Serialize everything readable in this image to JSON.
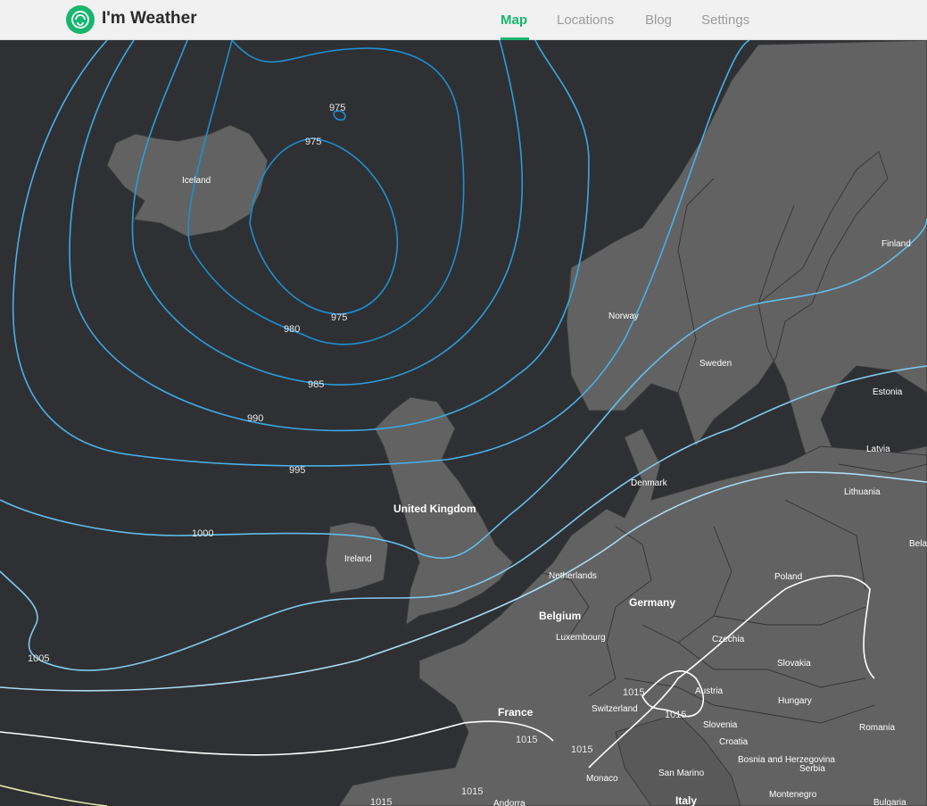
{
  "app": {
    "title": "I'm Weather"
  },
  "nav": {
    "items": [
      "Map",
      "Locations",
      "Blog",
      "Settings"
    ],
    "active": "Map"
  },
  "colors": {
    "accent": "#16b66f",
    "sea": "#2f3033",
    "land": "#626262"
  },
  "map": {
    "isobars": [
      "975",
      "975",
      "975",
      "980",
      "985",
      "990",
      "995",
      "1000",
      "1005",
      "1015",
      "1015",
      "1015",
      "1015",
      "1015",
      "1015"
    ],
    "countries": [
      "Iceland",
      "Norway",
      "Sweden",
      "Finland",
      "Estonia",
      "Latvia",
      "Lithuania",
      "Belar",
      "Denmark",
      "United Kingdom",
      "Ireland",
      "Netherlands",
      "Belgium",
      "Luxembourg",
      "Germany",
      "Poland",
      "Czechia",
      "Slovakia",
      "Austria",
      "Hungary",
      "Switzerland",
      "Slovenia",
      "Croatia",
      "Bosnia and Herzegovina",
      "Serbia",
      "Romania",
      "France",
      "Monaco",
      "San Marino",
      "Italy",
      "Montenegro",
      "Bulgaria",
      "Andorra"
    ]
  }
}
